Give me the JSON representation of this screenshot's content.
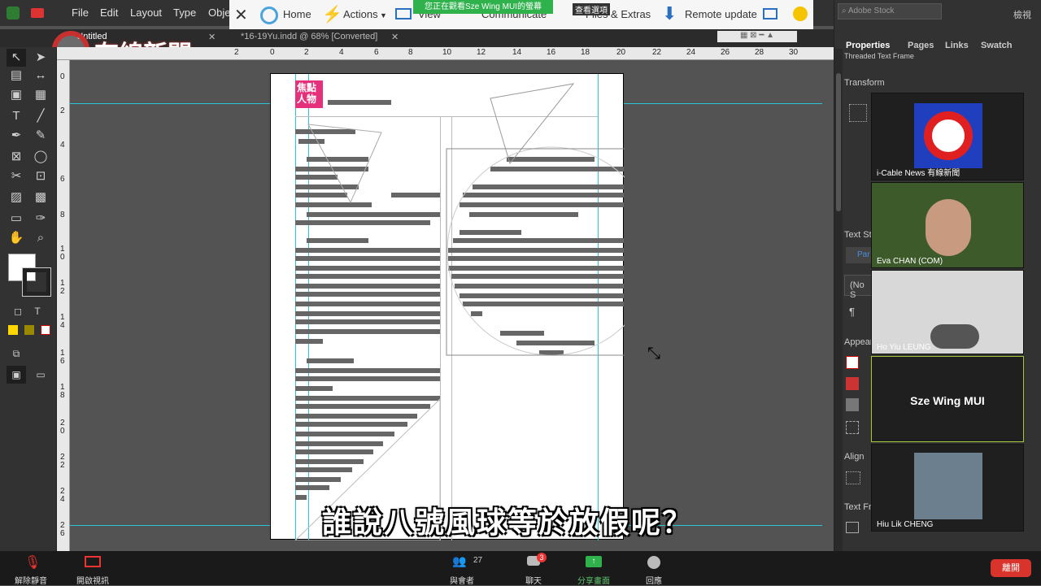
{
  "menubar": {
    "items": [
      "File",
      "Edit",
      "Layout",
      "Type",
      "Obje"
    ]
  },
  "doc_tabs": [
    "*Untitled",
    "*16-19Yu.indd @ 68% [Converted]"
  ],
  "watermark": "有線新聞",
  "zoom_toolbar": {
    "home": "Home",
    "actions": "Actions",
    "view": "View",
    "communicate": "Communicate",
    "files": "Files & Extras",
    "remote": "Remote update",
    "banner": "您正在觀看Sze Wing MUI的螢幕",
    "view_options": "查看選項"
  },
  "ruler_top": [
    "2",
    "0",
    "2",
    "4",
    "6",
    "8",
    "10",
    "12",
    "14",
    "16",
    "18",
    "20",
    "22",
    "24",
    "26",
    "28",
    "30"
  ],
  "ruler_left": [
    "0",
    "2",
    "4",
    "6",
    "8",
    "10",
    "12",
    "14",
    "16",
    "18",
    "20",
    "22",
    "24",
    "26"
  ],
  "page": {
    "tag": "焦點人物"
  },
  "right_panel": {
    "search_placeholder": "Adobe Stock",
    "tabs": [
      "Properties",
      "Pages",
      "Links",
      "Swatch"
    ],
    "threaded": "Threaded Text Frame",
    "transform": "Transform",
    "text_style": "Text St",
    "no_style": "(No S",
    "appearance": "Appear",
    "align": "Align",
    "text_frame": "Text Fr",
    "para": "Par",
    "top_right": "檢視"
  },
  "participants": [
    {
      "name": "i-Cable News 有線新聞"
    },
    {
      "name": "Eva CHAN (COM)"
    },
    {
      "name": "Ho Yiu LEUNG"
    },
    {
      "name": "Sze Wing MUI"
    },
    {
      "name": "Hiu Lik CHENG"
    }
  ],
  "bottom": {
    "mute": "解除靜音",
    "video": "開啟視訊",
    "participants": "與會者",
    "count": "27",
    "chat": "聊天",
    "chat_badge": "3",
    "share": "分享畫面",
    "reactions": "回應",
    "leave": "離開"
  },
  "subtitle": "誰說八號風球等於放假呢？"
}
